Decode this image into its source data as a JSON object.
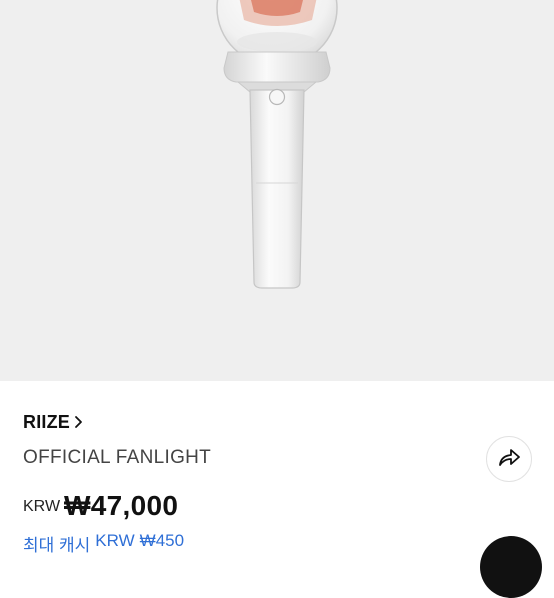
{
  "product": {
    "brand": "RIIZE",
    "name": "OFFICIAL FANLIGHT",
    "currency": "KRW",
    "price": "₩47,000",
    "cashback_label": "최대 캐시",
    "cashback_currency": "KRW",
    "cashback_amount": "₩450"
  },
  "icons": {
    "brand_chevron": "chevron-right-icon",
    "share": "share-icon"
  },
  "colors": {
    "hero_background": "#efefef",
    "cashback_text": "#2f6fd6",
    "floating_button": "#111111"
  }
}
